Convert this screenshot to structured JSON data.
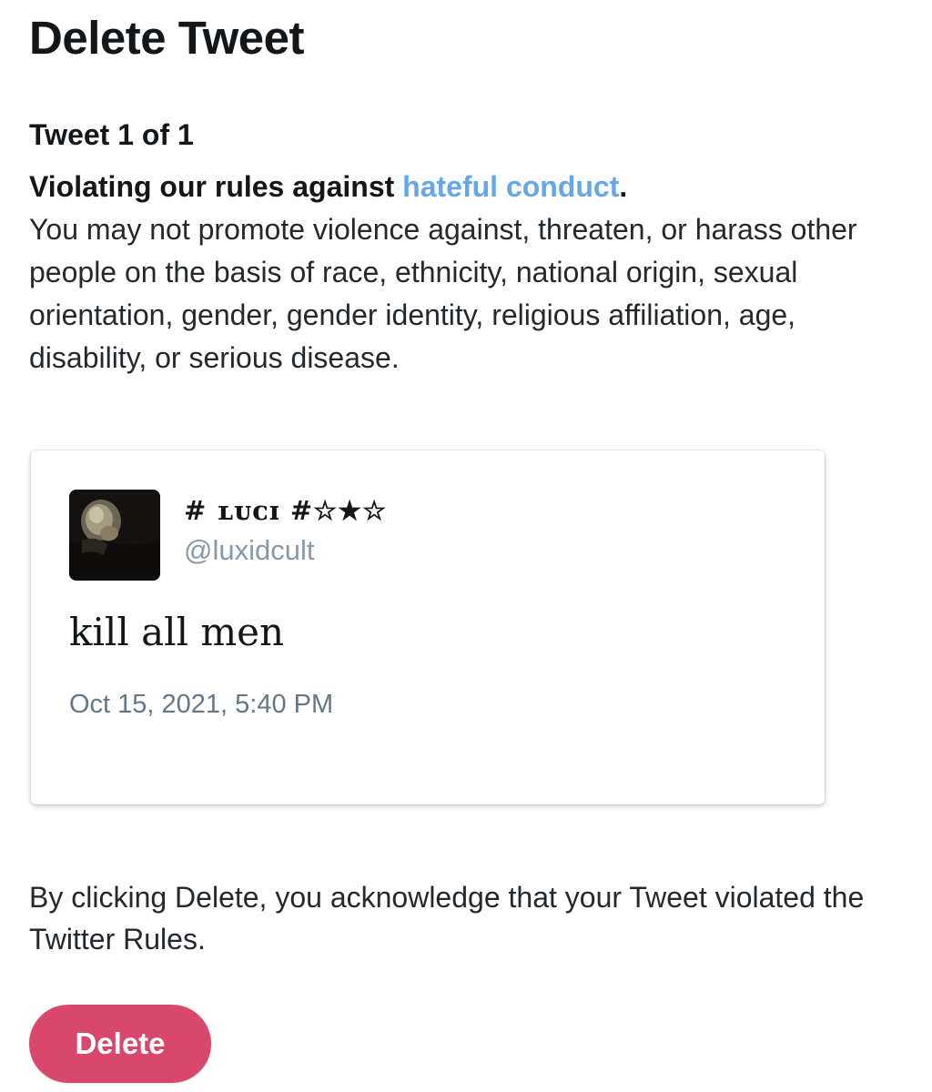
{
  "page": {
    "title": "Delete Tweet",
    "counter": "Tweet 1 of 1"
  },
  "violation": {
    "headline_prefix": "Violating our rules against ",
    "rule_link": "hateful conduct",
    "headline_suffix": ".",
    "description": "You may not promote violence against, threaten, or harass other people on the basis of race, ethnicity, national origin, sexual orientation, gender, gender identity, religious affiliation, age, disability, or serious disease."
  },
  "tweet": {
    "display_name": "# ʟᴜᴄɪ #☆★☆",
    "handle": "@luxidcult",
    "text": "kill all men",
    "timestamp": "Oct 15, 2021, 5:40 PM",
    "avatar_icon": "user-avatar-photo"
  },
  "footer": {
    "acknowledgement": "By clicking Delete, you acknowledge that your Tweet violated the Twitter Rules.",
    "delete_label": "Delete"
  },
  "colors": {
    "link": "#67a7e6",
    "delete_button": "#d9486c",
    "handle": "#8899a6",
    "timestamp": "#657786"
  }
}
